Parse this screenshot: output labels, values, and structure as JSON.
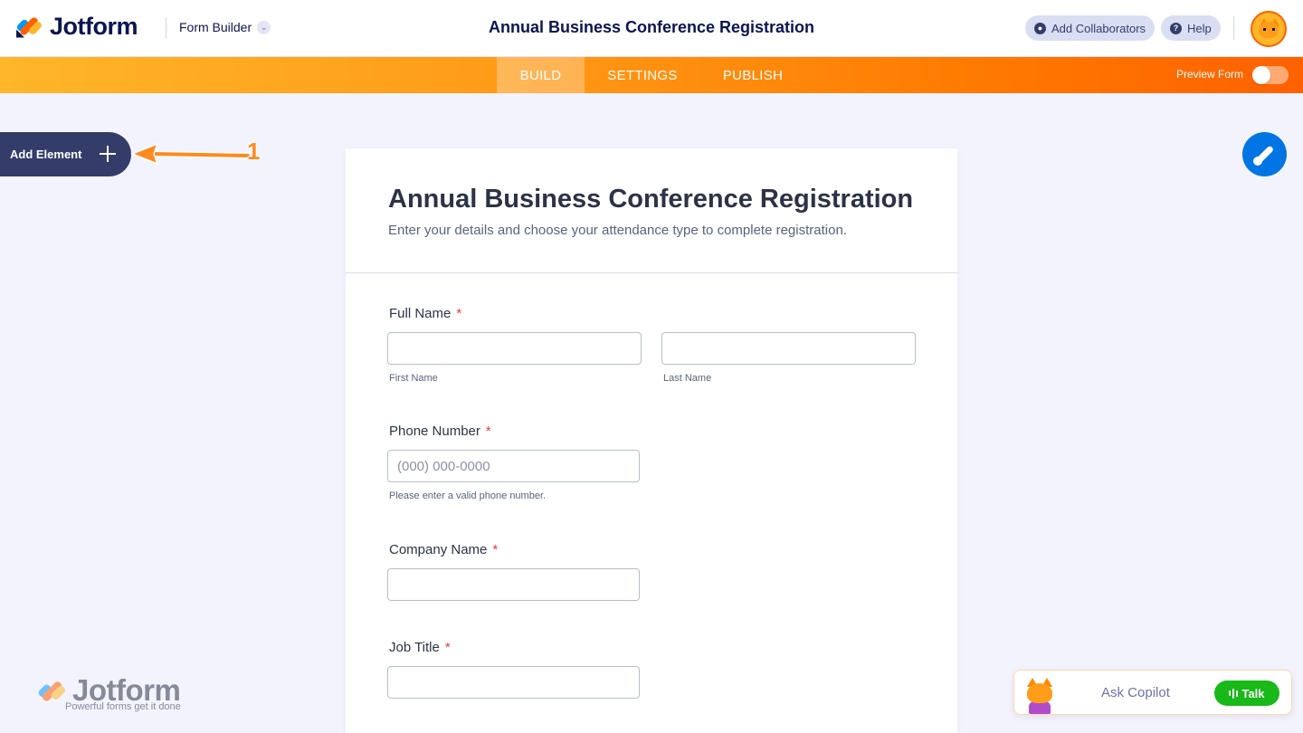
{
  "header": {
    "brand": "Jotform",
    "builder_switch": "Form Builder",
    "form_title": "Annual Business Conference Registration",
    "collaborators_label": "Add Collaborators",
    "help_label": "Help"
  },
  "nav": {
    "tabs": [
      "BUILD",
      "SETTINGS",
      "PUBLISH"
    ],
    "active_tab": "BUILD",
    "preview_label": "Preview Form",
    "preview_on": false
  },
  "sidebar": {
    "add_element_label": "Add Element"
  },
  "annotation": {
    "number": "1"
  },
  "form": {
    "title": "Annual Business Conference Registration",
    "subtitle": "Enter your details and choose your attendance type to complete registration.",
    "fields": {
      "full_name": {
        "label": "Full Name",
        "required_mark": "*",
        "first_sublabel": "First Name",
        "last_sublabel": "Last Name",
        "first_value": "",
        "last_value": ""
      },
      "phone": {
        "label": "Phone Number",
        "required_mark": "*",
        "placeholder": "(000) 000-0000",
        "sublabel": "Please enter a valid phone number.",
        "value": ""
      },
      "company": {
        "label": "Company Name",
        "required_mark": "*",
        "value": ""
      },
      "job_title": {
        "label": "Job Title",
        "required_mark": "*",
        "value": ""
      }
    }
  },
  "watermark": {
    "brand": "Jotform",
    "tagline": "Powerful forms get it done"
  },
  "copilot": {
    "ask_label": "Ask Copilot",
    "talk_label": "Talk"
  },
  "colors": {
    "brand_navy": "#0a1551",
    "orange_accent": "#ff6100",
    "blue_accent": "#0075e3",
    "required_red": "#f23a3c",
    "talk_green": "#18b918"
  }
}
